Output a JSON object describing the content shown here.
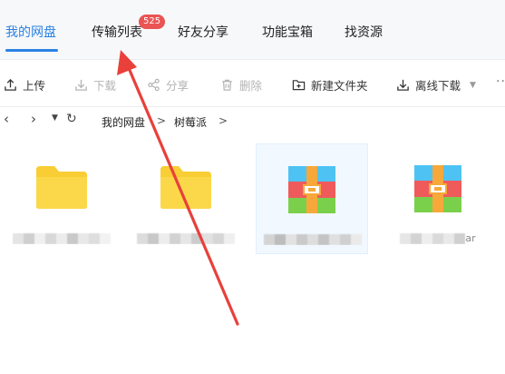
{
  "nav": {
    "tabs": [
      {
        "label": "我的网盘"
      },
      {
        "label": "传输列表",
        "badge": "525"
      },
      {
        "label": "好友分享"
      },
      {
        "label": "功能宝箱"
      },
      {
        "label": "找资源"
      }
    ]
  },
  "toolbar": {
    "upload": "上传",
    "download": "下载",
    "share": "分享",
    "delete": "删除",
    "new_folder": "新建文件夹",
    "offline_download": "离线下载",
    "more": "···"
  },
  "breadcrumb": {
    "root": "我的网盘",
    "folder": "树莓派",
    "sep": ">"
  },
  "files": [
    {
      "type": "folder",
      "name_tail": ""
    },
    {
      "type": "folder",
      "name_tail": ""
    },
    {
      "type": "archive",
      "name_tail": ""
    },
    {
      "type": "archive",
      "name_tail": "ar"
    }
  ],
  "colors": {
    "accent": "#2a82e4",
    "badge": "#ea5454",
    "folder": "#f9cd34",
    "annotation_arrow": "#e9403b"
  }
}
